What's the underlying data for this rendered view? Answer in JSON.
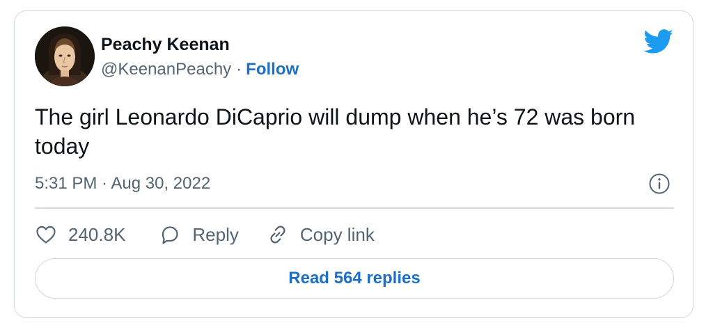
{
  "author": {
    "name": "Peachy Keenan",
    "handle": "@KeenanPeachy",
    "separator": "·",
    "follow_label": "Follow",
    "avatar": "portrait-avatar"
  },
  "tweet": {
    "text": "The girl Leonardo DiCaprio will dump when he’s 72 was born today",
    "timestamp": "5:31 PM · Aug 30, 2022"
  },
  "actions": {
    "like_count": "240.8K",
    "reply_label": "Reply",
    "copy_link_label": "Copy link"
  },
  "read_replies_label": "Read 564 replies",
  "icons": {
    "brand": "twitter-bird-icon",
    "info": "info-icon",
    "like": "heart-icon",
    "reply": "speech-bubble-icon",
    "copy_link": "link-icon"
  },
  "colors": {
    "brand_blue": "#1d9bf0",
    "link_blue": "#1d6fc4",
    "text_primary": "#0f1419",
    "text_secondary": "#536471",
    "border": "#cfd9de"
  }
}
